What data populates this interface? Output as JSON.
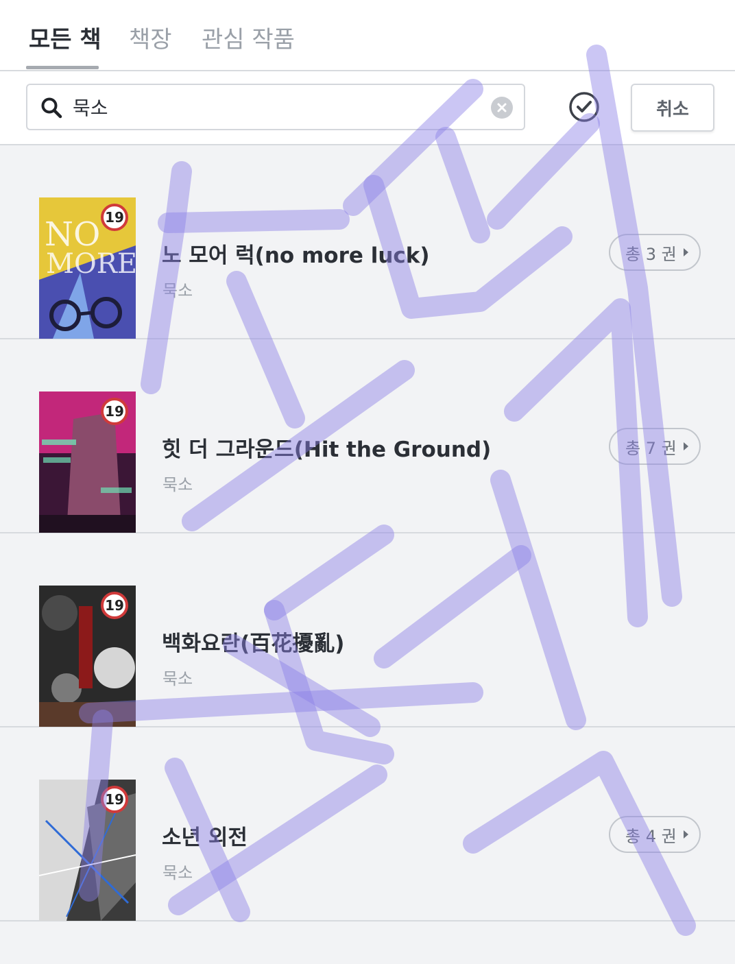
{
  "tabs": [
    {
      "label": "모든 책",
      "active": true
    },
    {
      "label": "책장",
      "active": false
    },
    {
      "label": "관심 작품",
      "active": false
    }
  ],
  "search": {
    "value": "묵소",
    "icon": "search-icon",
    "clear_icon": "clear-icon"
  },
  "toolbar": {
    "select_icon": "check-circle-icon",
    "cancel_label": "취소"
  },
  "books": [
    {
      "title": "노 모어 럭(no more luck)",
      "author": "묵소",
      "age_rating": "19",
      "volumes_label": "총 3 권",
      "cover_colors": [
        "#e6c73a",
        "#4a4fb0",
        "#1d1d3a"
      ]
    },
    {
      "title": "힛 더 그라운드(Hit the Ground)",
      "author": "묵소",
      "age_rating": "19",
      "volumes_label": "총 7 권",
      "cover_colors": [
        "#c2277a",
        "#3b1636",
        "#6fe0b4"
      ]
    },
    {
      "title": "백화요란(百花擾亂)",
      "author": "묵소",
      "age_rating": "19",
      "volumes_label": "",
      "cover_colors": [
        "#2a2a2a",
        "#8c1a1a",
        "#d6d6d6"
      ]
    },
    {
      "title": "소년 외전",
      "author": "묵소",
      "age_rating": "19",
      "volumes_label": "총 4 권",
      "cover_colors": [
        "#3b3b3b",
        "#d9d9d9",
        "#2f6bd6"
      ]
    }
  ],
  "overlay": {
    "scribble_color": "#8c80e6"
  }
}
